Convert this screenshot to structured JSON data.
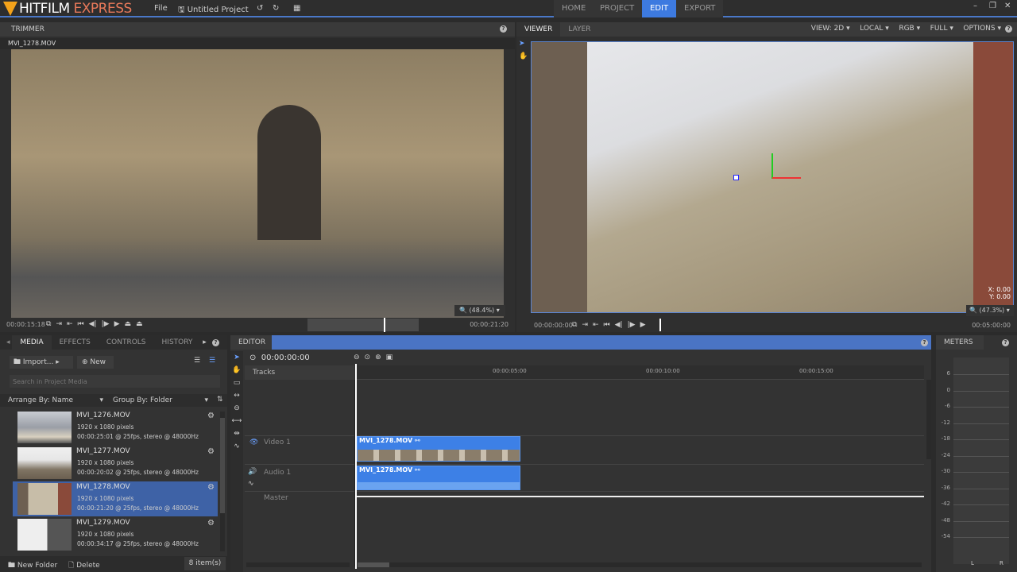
{
  "app": {
    "brand": "HITFILM",
    "brand_sub": "EXPRESS",
    "menu_file": "File",
    "project_name": "Untitled Project"
  },
  "nav": {
    "tabs": [
      {
        "label": "HOME"
      },
      {
        "label": "PROJECT"
      },
      {
        "label": "EDIT",
        "active": true
      },
      {
        "label": "EXPORT"
      }
    ]
  },
  "trimmer": {
    "title": "TRIMMER",
    "clip_name": "MVI_1278.MOV",
    "zoom": "(48.4%)",
    "current_time": "00:00:15:18",
    "end_time": "00:00:21:20",
    "progress": 0.72
  },
  "viewer": {
    "tabs": [
      "VIEWER",
      "LAYER"
    ],
    "view": "VIEW: 2D",
    "space": "LOCAL",
    "channel": "RGB",
    "quality": "FULL",
    "options": "OPTIONS",
    "zoom": "(47.3%)",
    "x_label": "X:",
    "x_value": "0.00",
    "y_label": "Y:",
    "y_value": "0.00",
    "current_time": "00:00:00:00",
    "end_time": "00:05:00:00"
  },
  "media": {
    "tabs": [
      "MEDIA",
      "EFFECTS",
      "CONTROLS",
      "HISTORY"
    ],
    "import_label": "Import...",
    "new_label": "New",
    "search_placeholder": "Search in Project Media",
    "arrange": "Arrange By: Name",
    "group": "Group By: Folder",
    "items": [
      {
        "name": "MVI_1276.MOV",
        "res": "1920 x 1080 pixels",
        "info": "00:00:25:01 @ 25fps, stereo @ 48000Hz"
      },
      {
        "name": "MVI_1277.MOV",
        "res": "1920 x 1080 pixels",
        "info": "00:00:20:02 @ 25fps, stereo @ 48000Hz"
      },
      {
        "name": "MVI_1278.MOV",
        "res": "1920 x 1080 pixels",
        "info": "00:00:21:20 @ 25fps, stereo @ 48000Hz",
        "selected": true
      },
      {
        "name": "MVI_1279.MOV",
        "res": "1920 x 1080 pixels",
        "info": "00:00:34:17 @ 25fps, stereo @ 48000Hz"
      }
    ],
    "new_folder": "New Folder",
    "delete": "Delete",
    "count": "8 item(s)"
  },
  "editor": {
    "title": "EDITOR",
    "timecode": "00:00:00:00",
    "tracks_label": "Tracks",
    "ruler": [
      "00:00:05:00",
      "00:00:10:00",
      "00:00:15:00"
    ],
    "video_track": "Video 1",
    "audio_track": "Audio 1",
    "master": "Master",
    "video_clip": "MVI_1278.MOV",
    "audio_clip": "MVI_1278.MOV"
  },
  "meters": {
    "title": "METERS",
    "ticks": [
      "6",
      "0",
      "-6",
      "-12",
      "-18",
      "-24",
      "-30",
      "-36",
      "-42",
      "-48",
      "-54"
    ],
    "left": "L",
    "right": "R"
  },
  "colors": {
    "accent": "#3d7ae0",
    "clip": "#3d80e6",
    "selected": "#3e62a6"
  }
}
